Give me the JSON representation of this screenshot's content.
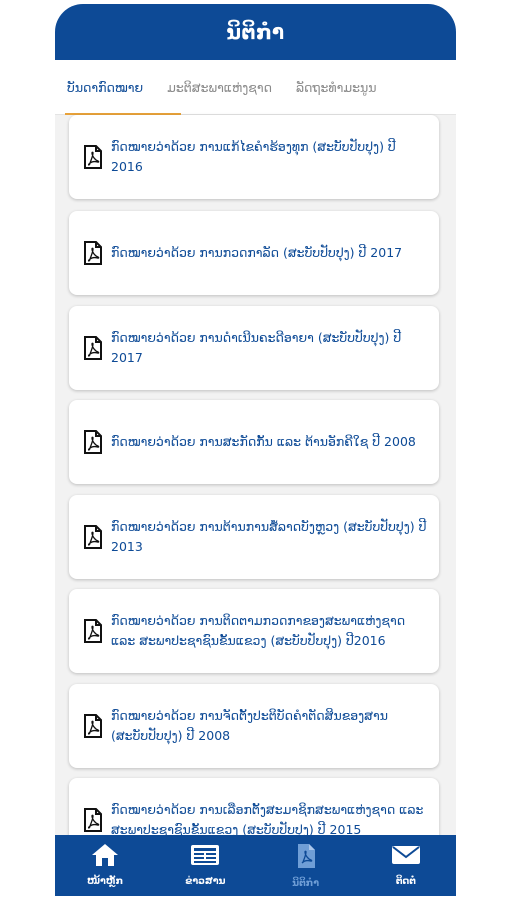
{
  "header": {
    "title": "ນິຕິກຳ"
  },
  "tabs": [
    {
      "label": "ບັນດາກົດໝາຍ"
    },
    {
      "label": "ມະຕິສະພາແຫ່ງຊາດ"
    },
    {
      "label": "ລັດຖະທຳມະນູນ"
    }
  ],
  "documents": [
    {
      "title": "ກົດໝາຍວ່າດ້ວຍ ການແກ້ໄຂຄຳຮ້ອງທຸກ (ສະບັບປັບປຸງ) ປີ 2016"
    },
    {
      "title": "ກົດໝາຍວ່າດ້ວຍ ການກວດກາລັດ (ສະບັບປັບປຸງ)  ປີ 2017"
    },
    {
      "title": "ກົດໝາຍວ່າດ້ວຍ ການດຳເນີນຄະດີອາຍາ (ສະບັບປັບປຸງ) ປີ 2017"
    },
    {
      "title": "ກົດໝາຍວ່າດ້ວຍ ການສະກັດກັ້ນ ແລະ ຕ້ານອັກຄີໃຊ  ປີ 2008"
    },
    {
      "title": "ກົດໝາຍວ່າດ້ວຍ ການຕ້ານການສໍ້ລາດບັງຫຼວງ (ສະບັບປັບປຸງ) ປີ 2013"
    },
    {
      "title": "ກົດໝາຍວ່າດ້ວຍ ການຕິດຕາມກວດກາຂອງສະພາແຫ່ງຊາດ ແລະ ສະພາປະຊາຊົນຂັ້ນແຂວງ (ສະບັບປັບປຸງ) ປີ2016"
    },
    {
      "title": "ກົດໝາຍວ່າດ້ວຍ ການຈັດຕັ້ງປະຕິບັດຄຳຕັດສິນຂອງສານ (ສະບັບປັບປຸງ) ປີ 2008"
    },
    {
      "title": "ກົດໝາຍວ່າດ້ວຍ ການເລືອກຕັ້ງສະມາຊິກສະພາແຫ່ງຊາດ ແລະ ສະພາປະຊາຊົນຂັ້ນແຂວງ (ສະບັບປັບປຸງ) ປີ 2015"
    }
  ],
  "nav": [
    {
      "label": "ໜ້າຫຼັກ",
      "icon": "home-icon"
    },
    {
      "label": "ຂ່າວສານ",
      "icon": "news-icon"
    },
    {
      "label": "ນິຕິກຳ",
      "icon": "document-icon"
    },
    {
      "label": "ຕິດຕໍ່",
      "icon": "mail-icon"
    }
  ],
  "colors": {
    "primary": "#0d4a96",
    "accent": "#e8a23a",
    "active_nav": "#6f9ed6"
  }
}
